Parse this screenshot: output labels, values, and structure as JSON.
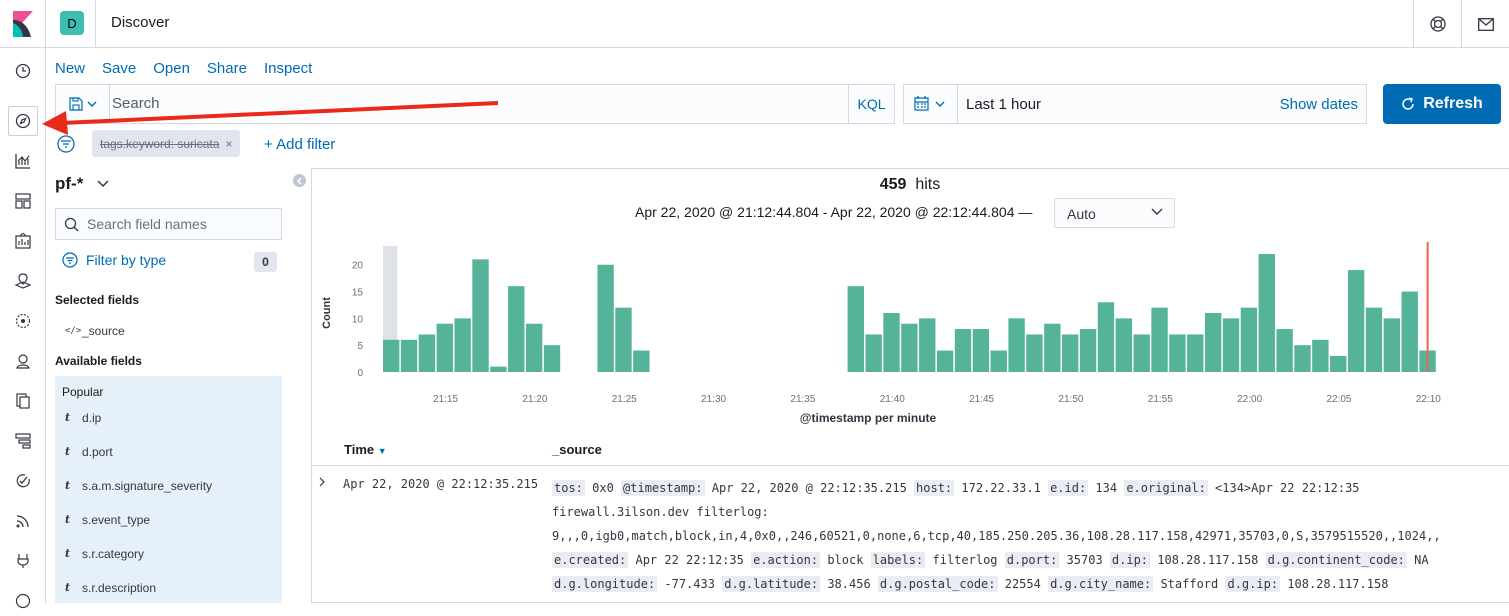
{
  "app": {
    "space_initial": "D",
    "title": "Discover"
  },
  "top_icons": [
    "help-icon",
    "mail-icon"
  ],
  "nav_icons": [
    "clock-icon",
    "compass-icon",
    "visualize-icon",
    "dashboard-icon",
    "canvas-icon",
    "maps-icon",
    "ml-icon",
    "siem-icon",
    "logs-icon",
    "uptime-icon",
    "apm-icon",
    "stack-icon",
    "dev-tools-icon",
    "monitoring-icon"
  ],
  "menu": {
    "new": "New",
    "save": "Save",
    "open": "Open",
    "share": "Share",
    "inspect": "Inspect"
  },
  "query": {
    "placeholder": "Search",
    "language": "KQL"
  },
  "date": {
    "range": "Last 1 hour",
    "show_dates": "Show dates"
  },
  "refresh": "Refresh",
  "filters": [
    {
      "label": "tags.keyword: suricata",
      "disabled": true
    }
  ],
  "add_filter": "+ Add filter",
  "index_pattern": "pf-*",
  "field_search_placeholder": "Search field names",
  "filter_by_type": "Filter by type",
  "filter_count": "0",
  "selected_fields_title": "Selected fields",
  "selected_fields": [
    {
      "type": "</>",
      "name": "_source"
    }
  ],
  "available_fields_title": "Available fields",
  "popular_title": "Popular",
  "popular_fields": [
    {
      "type": "t",
      "name": "d.ip"
    },
    {
      "type": "t",
      "name": "d.port"
    },
    {
      "type": "t",
      "name": "s.a.m.signature_severity"
    },
    {
      "type": "t",
      "name": "s.event_type"
    },
    {
      "type": "t",
      "name": "s.r.category"
    },
    {
      "type": "t",
      "name": "s.r.description"
    }
  ],
  "hits": {
    "count": "459",
    "label": "hits"
  },
  "time_range_text": "Apr 22, 2020 @ 21:12:44.804 - Apr 22, 2020 @ 22:12:44.804 —",
  "interval": "Auto",
  "chart_data": {
    "type": "bar",
    "ylabel": "Count",
    "xlabel": "@timestamp per minute",
    "yticks": [
      0,
      5,
      10,
      15,
      20
    ],
    "ylim": [
      0,
      22
    ],
    "xtick_labels": [
      "21:15",
      "21:20",
      "21:25",
      "21:30",
      "21:35",
      "21:40",
      "21:45",
      "21:50",
      "21:55",
      "22:00",
      "22:05",
      "22:10"
    ],
    "bar_color": "#54b399",
    "values": [
      6,
      6,
      7,
      9,
      10,
      21,
      1,
      16,
      9,
      5,
      0,
      0,
      20,
      12,
      4,
      0,
      0,
      0,
      0,
      0,
      0,
      0,
      0,
      0,
      0,
      0,
      16,
      7,
      11,
      9,
      10,
      4,
      8,
      8,
      4,
      10,
      7,
      9,
      7,
      8,
      13,
      10,
      7,
      12,
      7,
      7,
      11,
      10,
      12,
      22,
      8,
      5,
      6,
      3,
      19,
      12,
      10,
      15,
      4
    ],
    "categories": [
      "21:12",
      "21:13",
      "21:14",
      "21:15",
      "21:16",
      "21:17",
      "21:18",
      "21:19",
      "21:20",
      "21:21",
      "21:22",
      "21:23",
      "21:24",
      "21:25",
      "21:26",
      "21:27",
      "21:28",
      "21:29",
      "21:30",
      "21:31",
      "21:32",
      "21:33",
      "21:34",
      "21:35",
      "21:36",
      "21:37",
      "21:38",
      "21:39",
      "21:40",
      "21:41",
      "21:42",
      "21:43",
      "21:44",
      "21:45",
      "21:46",
      "21:47",
      "21:48",
      "21:49",
      "21:50",
      "21:51",
      "21:52",
      "21:53",
      "21:54",
      "21:55",
      "21:56",
      "21:57",
      "21:58",
      "21:59",
      "22:00",
      "22:01",
      "22:02",
      "22:03",
      "22:04",
      "22:05",
      "22:06",
      "22:07",
      "22:08",
      "22:09",
      "22:10"
    ]
  },
  "table": {
    "headers": {
      "time": "Time",
      "source": "_source"
    },
    "row": {
      "time": "Apr 22, 2020 @ 22:12:35.215",
      "source_pairs": [
        [
          "tos:",
          "0x0"
        ],
        [
          "@timestamp:",
          "Apr 22, 2020 @ 22:12:35.215"
        ],
        [
          "host:",
          "172.22.33.1"
        ],
        [
          "e.id:",
          "134"
        ],
        [
          "e.original:",
          "<134>Apr 22 22:12:35 firewall.3ilson.dev filterlog: 9,,,0,igb0,match,block,in,4,0x0,,246,60521,0,none,6,tcp,40,185.250.205.36,108.28.117.158,42971,35703,0,S,3579515520,,1024,,"
        ],
        [
          "e.created:",
          "Apr 22 22:12:35"
        ],
        [
          "e.action:",
          "block"
        ],
        [
          "labels:",
          "filterlog"
        ],
        [
          "d.port:",
          "35703"
        ],
        [
          "d.ip:",
          "108.28.117.158"
        ],
        [
          "d.g.continent_code:",
          "NA"
        ],
        [
          "d.g.longitude:",
          "-77.433"
        ],
        [
          "d.g.latitude:",
          "38.456"
        ],
        [
          "d.g.postal_code:",
          "22554"
        ],
        [
          "d.g.city_name:",
          "Stafford"
        ],
        [
          "d.g.ip:",
          "108.28.117.158"
        ]
      ]
    }
  }
}
